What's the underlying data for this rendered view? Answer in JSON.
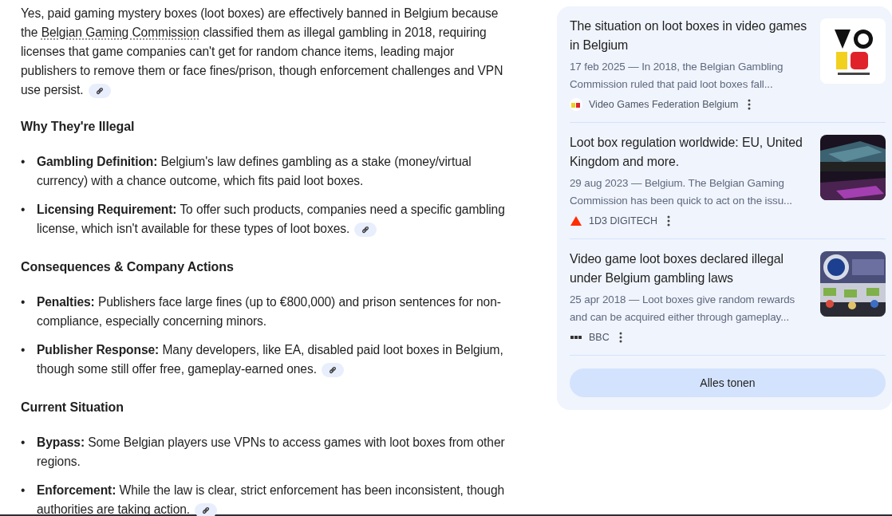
{
  "intro": {
    "before": "Yes, paid gaming mystery boxes (loot boxes) are effectively banned in Belgium because the ",
    "link": "Belgian Gaming Commission",
    "after": " classified them as illegal gambling in 2018, requiring licenses that game companies can't get for random chance items, leading major publishers to remove them or face fines/prison, though enforcement challenges and VPN use persist.",
    "cited": true
  },
  "sections": [
    {
      "heading": "Why They're Illegal",
      "items": [
        {
          "bullet": "•",
          "text": "**Gambling Definition:** Belgium's law defines gambling as a stake (money/virtual currency) with a chance outcome, which fits paid loot boxes.",
          "cited": false
        },
        {
          "bullet": "•",
          "text": "**Licensing Requirement:** To offer such products, companies need a specific gambling license, which isn't available for these types of loot boxes.",
          "cited": true
        }
      ]
    },
    {
      "heading": "Consequences & Company Actions",
      "items": [
        {
          "bullet": "•",
          "text": "**Penalties:** Publishers face large fines (up to €800,000) and prison sentences for non-compliance, especially concerning minors.",
          "cited": false
        },
        {
          "bullet": "•",
          "text": "**Publisher Response:** Many developers, like EA, disabled paid loot boxes in Belgium, though some still offer free, gameplay-earned ones.",
          "cited": true
        }
      ]
    },
    {
      "heading": "Current Situation",
      "items": [
        {
          "bullet": "•",
          "text": "**Bypass:** Some Belgian players use VPNs to access games with loot boxes from other regions.",
          "cited": false
        },
        {
          "bullet": "•",
          "text": "**Enforcement:** While the law is clear, strict enforcement has been inconsistent, though authorities are taking action.",
          "cited": true
        }
      ]
    }
  ],
  "sources": [
    {
      "title": "The situation on loot boxes in video games in Belgium",
      "snippet": "17 feb 2025 — In 2018, the Belgian Gambling Commission ruled that paid loot boxes fall...",
      "site": "Video Games Federation Belgium"
    },
    {
      "title": "Loot box regulation worldwide: EU, United Kingdom and more.",
      "snippet": "29 aug 2023 — Belgium. The Belgian Gaming Commission has been quick to act on the issu...",
      "site": "1D3 DIGITECH"
    },
    {
      "title": "Video game loot boxes declared illegal under Belgium gambling laws",
      "snippet": "25 apr 2018 — Loot boxes give random rewards and can be acquired either through gameplay...",
      "site": "BBC"
    }
  ],
  "show_all": "Alles tonen"
}
